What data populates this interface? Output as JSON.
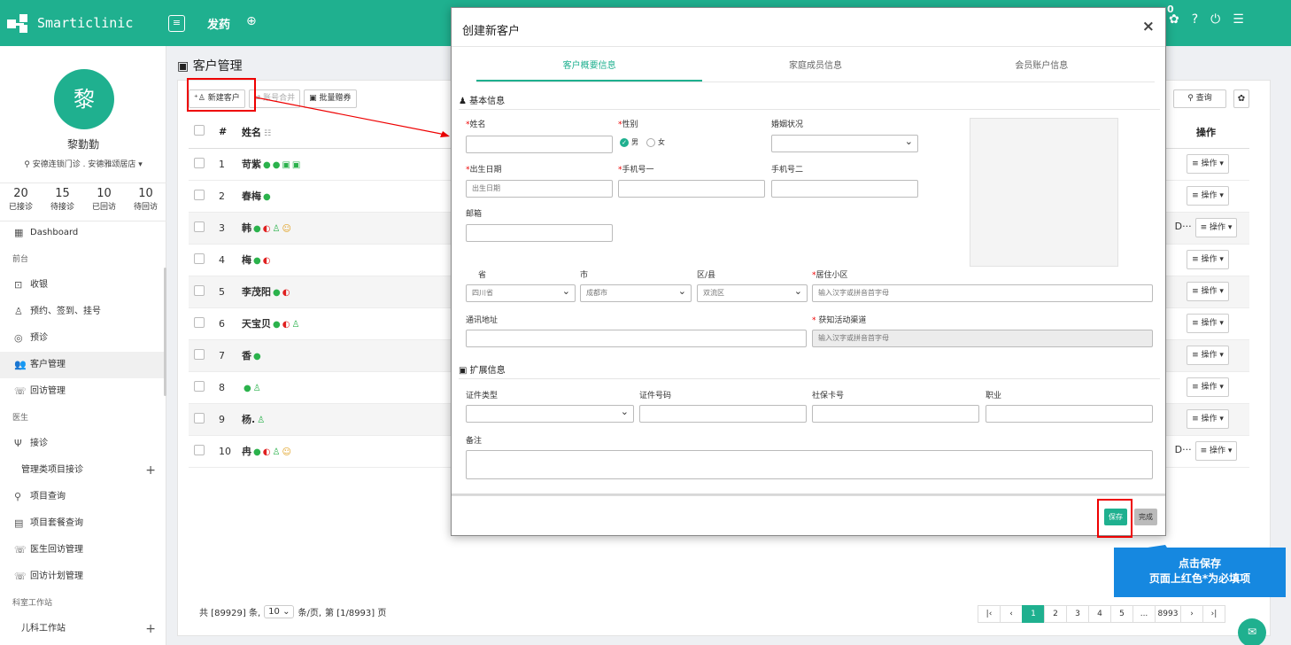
{
  "topbar": {
    "app_name": "Smarticlinic",
    "menu_icon": "≡",
    "module": "发药",
    "badge": "0",
    "icons": [
      "settings-icon",
      "help-icon",
      "power-icon",
      "list-icon"
    ]
  },
  "sidebar": {
    "avatar_char": "黎",
    "user_name": "黎勤勤",
    "store": "安德连锁门诊 . 安德雅颂居店",
    "stats": [
      {
        "num": "20",
        "label": "已接诊"
      },
      {
        "num": "15",
        "label": "待接诊"
      },
      {
        "num": "10",
        "label": "已回访"
      },
      {
        "num": "10",
        "label": "待回访"
      }
    ],
    "nav": {
      "dashboard": "Dashboard",
      "group_front": "前台",
      "cashier": "收银",
      "booking": "预约、签到、挂号",
      "pre_diag": "预诊",
      "customer": "客户管理",
      "followup": "回访管理",
      "group_doctor": "医生",
      "diagnosis": "接诊",
      "mgmt_items": "管理类项目接诊",
      "item_query": "项目查询",
      "package_query": "项目套餐查询",
      "doctor_followup": "医生回访管理",
      "plan_mgmt": "回访计划管理",
      "group_dept": "科室工作站",
      "pediatric": "儿科工作站"
    }
  },
  "main": {
    "page_title": "客户管理",
    "toolbar": {
      "new_customer": "新建客户",
      "merge": "账号合并",
      "batch_gift": "批量赠券"
    },
    "query": "查询",
    "headers": {
      "num": "#",
      "name": "姓名",
      "op": "操作"
    },
    "rows": [
      {
        "n": "1",
        "name": "苛紫",
        "extra": ""
      },
      {
        "n": "2",
        "name": "春梅",
        "extra": ""
      },
      {
        "n": "3",
        "name": "韩",
        "extra": "D···"
      },
      {
        "n": "4",
        "name": "梅",
        "extra": ""
      },
      {
        "n": "5",
        "name": "李茂阳",
        "extra": ""
      },
      {
        "n": "6",
        "name": "天宝贝",
        "extra": ""
      },
      {
        "n": "7",
        "name": "香",
        "extra": ""
      },
      {
        "n": "8",
        "name": "",
        "extra": ""
      },
      {
        "n": "9",
        "name": "杨.",
        "extra": ""
      },
      {
        "n": "10",
        "name": "冉",
        "extra": "D···"
      }
    ],
    "op_label": "≡ 操作 ▾",
    "pager": {
      "total_prefix": "共 [89929] 条,",
      "page_size": "10",
      "per_page": "条/页,",
      "page_info": "第 [1/8993] 页",
      "pages": [
        "|‹",
        "‹",
        "1",
        "2",
        "3",
        "4",
        "5",
        "...",
        "8993",
        "›",
        "›|"
      ]
    }
  },
  "modal": {
    "title": "创建新客户",
    "close": "×",
    "tabs": [
      "客户概要信息",
      "家庭成员信息",
      "会员账户信息"
    ],
    "basic_title": "基本信息",
    "name_label": "姓名",
    "gender_label": "性别",
    "gender_male": "男",
    "gender_female": "女",
    "marital_label": "婚姻状况",
    "birth_label": "出生日期",
    "birth_placeholder": "出生日期",
    "phone1_label": "手机号一",
    "phone2_label": "手机号二",
    "email_label": "邮箱",
    "province_label": "省",
    "city_label": "市",
    "district_label": "区/县",
    "community_label": "居住小区",
    "province_value": "四川省",
    "city_value": "成都市",
    "district_value": "双流区",
    "community_placeholder": "输入汉字或拼音首字母",
    "address_label": "通讯地址",
    "channel_label": "获知活动渠道",
    "channel_placeholder": "输入汉字或拼音首字母",
    "ext_title": "扩展信息",
    "id_type_label": "证件类型",
    "id_no_label": "证件号码",
    "social_label": "社保卡号",
    "job_label": "职业",
    "remark_label": "备注",
    "save": "保存",
    "done": "完成"
  },
  "callout": {
    "line1": "点击保存",
    "line2": "页面上红色*为必填项"
  },
  "colors": {
    "brand": "#1fb08f",
    "highlight": "#e00000",
    "callout": "#1688e0"
  }
}
